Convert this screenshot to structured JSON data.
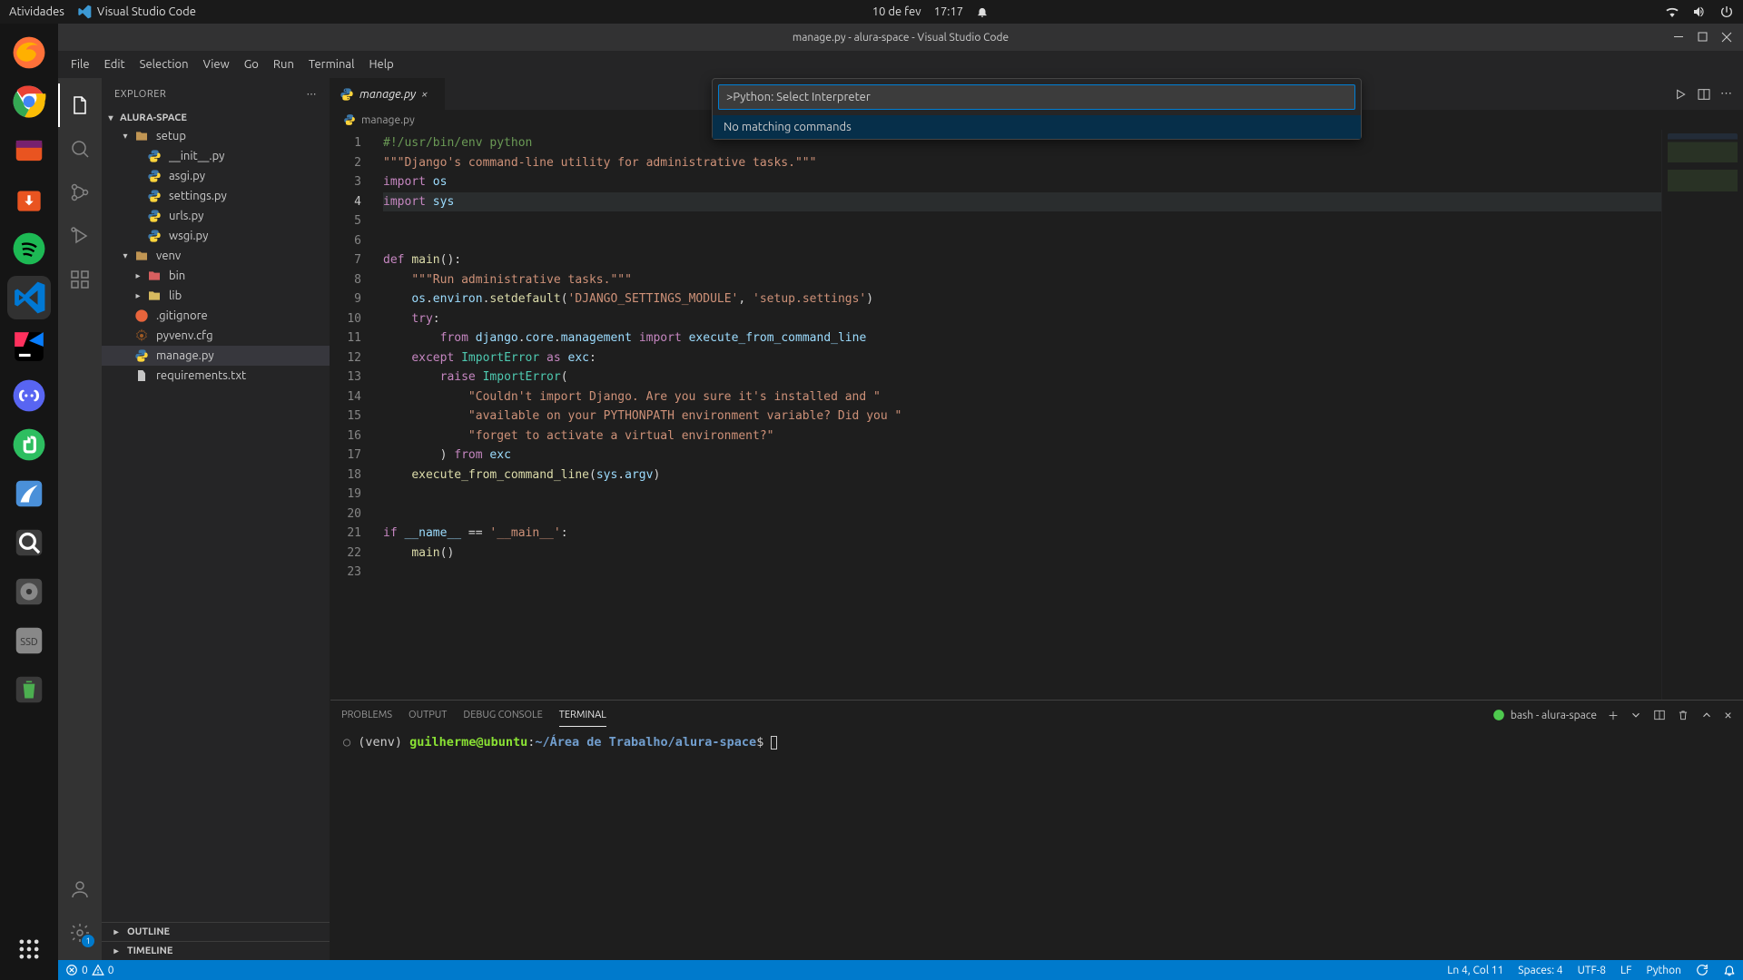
{
  "gnome": {
    "activities": "Atividades",
    "app": "Visual Studio Code",
    "date": "10 de fev",
    "time": "17:17"
  },
  "vscode": {
    "title": "manage.py - alura-space - Visual Studio Code",
    "menu": [
      "File",
      "Edit",
      "Selection",
      "View",
      "Go",
      "Run",
      "Terminal",
      "Help"
    ],
    "explorer": {
      "title": "EXPLORER",
      "root": "ALURA-SPACE",
      "tree": {
        "setup": {
          "label": "setup",
          "children": [
            "__init__.py",
            "asgi.py",
            "settings.py",
            "urls.py",
            "wsgi.py"
          ]
        },
        "venv": {
          "label": "venv",
          "children": [
            "bin",
            "lib"
          ]
        },
        "loose": [
          ".gitignore",
          "pyvenv.cfg",
          "manage.py",
          "requirements.txt"
        ]
      },
      "outline": "OUTLINE",
      "timeline": "TIMELINE"
    },
    "tab": {
      "label": "manage.py"
    },
    "breadcrumb": "manage.py",
    "palette": {
      "value": ">Python: Select Interpreter",
      "result": "No matching commands"
    },
    "code": {
      "lines": [
        {
          "n": 1,
          "html": "<span class='com'>#!/usr/bin/env python</span>"
        },
        {
          "n": 2,
          "html": "<span class='str'>\"\"\"Django's command-line utility for administrative tasks.\"\"\"</span>"
        },
        {
          "n": 3,
          "html": "<span class='kw'>import</span> <span class='var'>os</span>"
        },
        {
          "n": 4,
          "html": "<span class='kw'>import</span> <span class='var'>sys</span>"
        },
        {
          "n": 5,
          "html": ""
        },
        {
          "n": 6,
          "html": ""
        },
        {
          "n": 7,
          "html": "<span class='kw'>def</span> <span class='fn'>main</span>():"
        },
        {
          "n": 8,
          "html": "    <span class='str'>\"\"\"Run administrative tasks.\"\"\"</span>"
        },
        {
          "n": 9,
          "html": "    <span class='var'>os</span>.<span class='var'>environ</span>.<span class='fn'>setdefault</span>(<span class='str'>'DJANGO_SETTINGS_MODULE'</span>, <span class='str'>'setup.settings'</span>)"
        },
        {
          "n": 10,
          "html": "    <span class='kw'>try</span>:"
        },
        {
          "n": 11,
          "html": "        <span class='kw'>from</span> <span class='var'>django</span>.<span class='var'>core</span>.<span class='var'>management</span> <span class='kw'>import</span> <span class='var'>execute_from_command_line</span>"
        },
        {
          "n": 12,
          "html": "    <span class='kw'>except</span> <span class='cls'>ImportError</span> <span class='kw'>as</span> <span class='var'>exc</span>:"
        },
        {
          "n": 13,
          "html": "        <span class='kw'>raise</span> <span class='cls'>ImportError</span>("
        },
        {
          "n": 14,
          "html": "            <span class='str'>\"Couldn't import Django. Are you sure it's installed and \"</span>"
        },
        {
          "n": 15,
          "html": "            <span class='str'>\"available on your PYTHONPATH environment variable? Did you \"</span>"
        },
        {
          "n": 16,
          "html": "            <span class='str'>\"forget to activate a virtual environment?\"</span>"
        },
        {
          "n": 17,
          "html": "        ) <span class='kw'>from</span> <span class='var'>exc</span>"
        },
        {
          "n": 18,
          "html": "    <span class='fn'>execute_from_command_line</span>(<span class='var'>sys</span>.<span class='var'>argv</span>)"
        },
        {
          "n": 19,
          "html": ""
        },
        {
          "n": 20,
          "html": ""
        },
        {
          "n": 21,
          "html": "<span class='kw'>if</span> <span class='var'>__name__</span> == <span class='str'>'__main__'</span>:"
        },
        {
          "n": 22,
          "html": "    <span class='fn'>main</span>()"
        },
        {
          "n": 23,
          "html": ""
        }
      ],
      "activeLine": 4
    },
    "panel": {
      "tabs": [
        "PROBLEMS",
        "OUTPUT",
        "DEBUG CONSOLE",
        "TERMINAL"
      ],
      "active": "TERMINAL",
      "term_label": "bash - alura-space",
      "prompt": {
        "venv": "(venv) ",
        "user": "guilherme@ubuntu",
        "colon": ":",
        "path": "~/Área de Trabalho/alura-space",
        "dollar": "$ "
      }
    },
    "status": {
      "errors": "0",
      "warnings": "0",
      "ln": "Ln 4, Col 11",
      "spaces": "Spaces: 4",
      "enc": "UTF-8",
      "eol": "LF",
      "lang": "Python"
    },
    "activity_badge": "1"
  }
}
